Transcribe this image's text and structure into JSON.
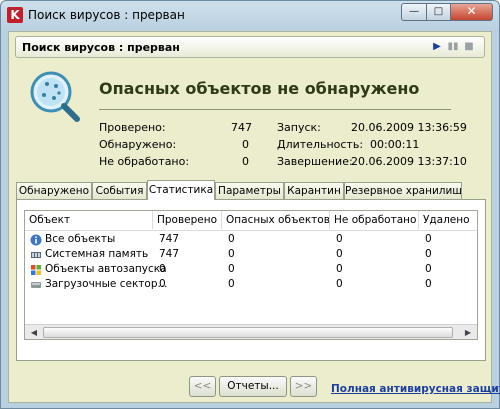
{
  "window": {
    "title": "Поиск вирусов : прерван",
    "logo_letter": "K",
    "min_glyph": "—",
    "max_glyph": "□",
    "close_glyph": "✕"
  },
  "header": {
    "title": "Поиск вирусов : прерван",
    "play_glyph": "▶",
    "pause_glyph": "▮▮",
    "stop_glyph": "■"
  },
  "result": {
    "title": "Опасных объектов не обнаружено",
    "icon": "magnifier-shield-icon"
  },
  "stats": {
    "checked_label": "Проверено:",
    "checked_value": "747",
    "found_label": "Обнаружено:",
    "found_value": "0",
    "unprocessed_label": "Не обработано:",
    "unprocessed_value": "0",
    "start_label": "Запуск:",
    "start_value": "20.06.2009 13:36:59",
    "duration_label": "Длительность:",
    "duration_value": "00:00:11",
    "end_label": "Завершение:",
    "end_value": "20.06.2009 13:37:10"
  },
  "tabs": [
    {
      "label": "Обнаружено"
    },
    {
      "label": "События"
    },
    {
      "label": "Статистика",
      "active": true
    },
    {
      "label": "Параметры"
    },
    {
      "label": "Карантин"
    },
    {
      "label": "Резервное хранилище"
    }
  ],
  "table": {
    "columns": [
      "Объект",
      "Проверено",
      "Опасных объектов",
      "Не обработано",
      "Удалено"
    ],
    "rows": [
      {
        "name": "Все объекты",
        "icon": "info-icon",
        "checked": "747",
        "dangerous": "0",
        "unprocessed": "0",
        "deleted": "0"
      },
      {
        "name": "Системная память",
        "icon": "memory-chip-icon",
        "checked": "747",
        "dangerous": "0",
        "unprocessed": "0",
        "deleted": "0"
      },
      {
        "name": "Объекты автозапуска",
        "icon": "windows-flag-icon",
        "checked": "0",
        "dangerous": "0",
        "unprocessed": "0",
        "deleted": "0"
      },
      {
        "name": "Загрузочные сектор...",
        "icon": "drive-icon",
        "checked": "0",
        "dangerous": "0",
        "unprocessed": "0",
        "deleted": "0"
      }
    ]
  },
  "scrollbar": {
    "left_glyph": "◀",
    "right_glyph": "▶"
  },
  "footer": {
    "prev_label": "<<",
    "reports_label": "Отчеты...",
    "next_label": ">>",
    "link_label": "Полная антивирусная защита"
  },
  "colors": {
    "accent_link": "#1d3fa0",
    "panel_bg": "#ecedcc",
    "logo_red": "#c21f2b"
  }
}
